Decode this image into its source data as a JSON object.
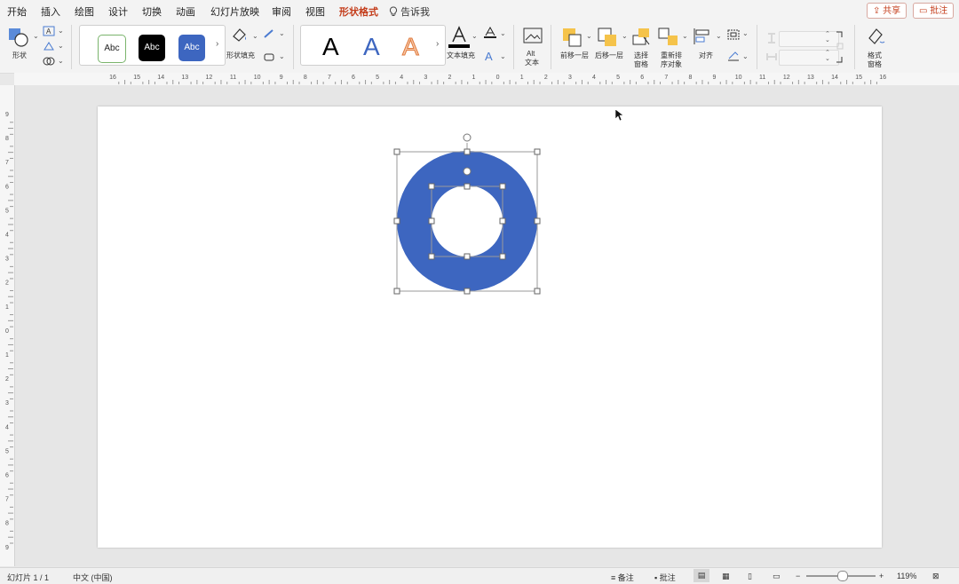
{
  "tabs": [
    {
      "label": "开始"
    },
    {
      "label": "插入"
    },
    {
      "label": "绘图"
    },
    {
      "label": "设计"
    },
    {
      "label": "切换"
    },
    {
      "label": "动画"
    },
    {
      "label": "幻灯片放映"
    },
    {
      "label": "审阅"
    },
    {
      "label": "视图"
    },
    {
      "label": "形状格式",
      "active": true
    }
  ],
  "tell_me": "告诉我",
  "share_label": "共享",
  "comment_label": "批注",
  "ribbon": {
    "shapes_label": "形状",
    "style_samples": [
      "Abc",
      "Abc",
      "Abc"
    ],
    "shape_fill_label": "形状填充",
    "wordart_samples": [
      "A",
      "A",
      "A"
    ],
    "text_fill_label": "文本填充",
    "alt_text_label_1": "Alt",
    "alt_text_label_2": "文本",
    "bring_forward_label": "前移一层",
    "send_backward_label": "后移一层",
    "selection_pane_label_1": "选择",
    "selection_pane_label_2": "窗格",
    "reorder_label_1": "重新排",
    "reorder_label_2": "序对象",
    "align_label": "对齐",
    "format_pane_label_1": "格式",
    "format_pane_label_2": "窗格",
    "height_value": "",
    "width_value": ""
  },
  "colors": {
    "accent": "#c43e1c",
    "shape_fill": "#3d66c0"
  },
  "ruler": {
    "h_ticks": [
      "16",
      "15",
      "14",
      "13",
      "12",
      "11",
      "10",
      "9",
      "8",
      "7",
      "6",
      "5",
      "4",
      "3",
      "2",
      "1",
      "0",
      "1",
      "2",
      "3",
      "4",
      "5",
      "6",
      "7",
      "8",
      "9",
      "10",
      "11",
      "12",
      "13",
      "14",
      "15",
      "16"
    ],
    "v_ticks": [
      "9",
      "8",
      "7",
      "6",
      "5",
      "4",
      "3",
      "2",
      "1",
      "0",
      "1",
      "2",
      "3",
      "4",
      "5",
      "6",
      "7",
      "8",
      "9"
    ]
  },
  "status": {
    "slide_info": "幻灯片 1 / 1",
    "language": "中文 (中国)",
    "notes_label": "备注",
    "comments_label": "批注",
    "zoom": "119%"
  }
}
